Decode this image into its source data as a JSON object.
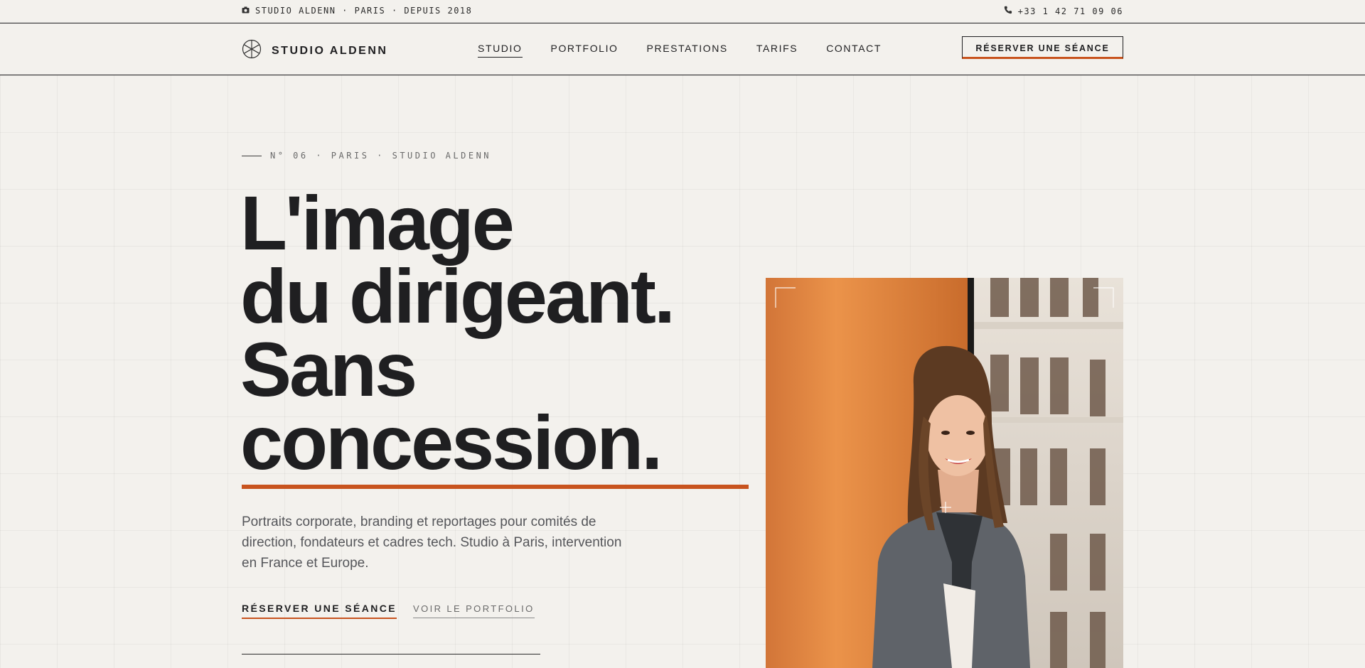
{
  "topbar": {
    "left_text": "STUDIO ALDENN · PARIS · DEPUIS 2018",
    "phone": "+33 1 42 71 09 06",
    "left_icon": "camera-icon",
    "right_icon": "phone-icon"
  },
  "nav": {
    "brand": "STUDIO ALDENN",
    "brand_icon": "aperture-icon",
    "items": [
      {
        "label": "STUDIO",
        "active": true
      },
      {
        "label": "PORTFOLIO"
      },
      {
        "label": "PRESTATIONS"
      },
      {
        "label": "TARIFS"
      },
      {
        "label": "CONTACT"
      }
    ],
    "cta": "RÉSERVER UNE SÉANCE"
  },
  "hero": {
    "eyebrow": "N° 06 · PARIS · STUDIO ALDENN",
    "headline": [
      "L'image",
      "du dirigeant.",
      "Sans",
      "concession."
    ],
    "lede": "Portraits corporate, branding et reportages pour comités de direction, fondateurs et cadres tech. Studio à Paris, intervention en France et Europe.",
    "primary_cta": "RÉSERVER UNE SÉANCE",
    "secondary_cta": "VOIR LE PORTFOLIO"
  },
  "colors": {
    "accent": "#c8531e",
    "ink": "#1f1f21",
    "background": "#f3f1ed",
    "muted": "#55565a"
  }
}
